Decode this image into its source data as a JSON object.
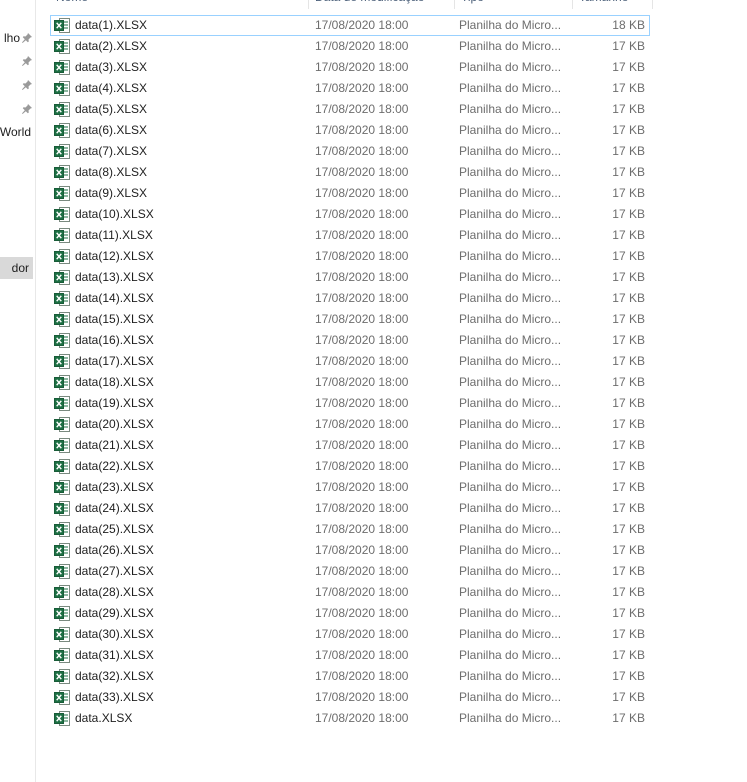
{
  "columns": {
    "name": "Nome",
    "date": "Data de modificação",
    "type": "Tipo",
    "size": "Tamanho"
  },
  "nav": {
    "items": [
      {
        "label": "lho",
        "pinned": true
      },
      {
        "label": "",
        "pinned": true
      },
      {
        "label": "",
        "pinned": true
      },
      {
        "label": "",
        "pinned": true
      },
      {
        "label": "World",
        "pinned": false
      },
      {
        "label": "dor",
        "pinned": false,
        "selected": true
      }
    ]
  },
  "icons": {
    "file": "excel-file-icon",
    "pin": "pin-icon"
  },
  "colors": {
    "excel_green": "#1d7044",
    "focus_border": "#99d1ff",
    "nav_selected": "#d9d9d9"
  },
  "files": [
    {
      "name": "data(1).XLSX",
      "date": "17/08/2020 18:00",
      "type": "Planilha do Micro...",
      "size": "18 KB"
    },
    {
      "name": "data(2).XLSX",
      "date": "17/08/2020 18:00",
      "type": "Planilha do Micro...",
      "size": "17 KB"
    },
    {
      "name": "data(3).XLSX",
      "date": "17/08/2020 18:00",
      "type": "Planilha do Micro...",
      "size": "17 KB"
    },
    {
      "name": "data(4).XLSX",
      "date": "17/08/2020 18:00",
      "type": "Planilha do Micro...",
      "size": "17 KB"
    },
    {
      "name": "data(5).XLSX",
      "date": "17/08/2020 18:00",
      "type": "Planilha do Micro...",
      "size": "17 KB"
    },
    {
      "name": "data(6).XLSX",
      "date": "17/08/2020 18:00",
      "type": "Planilha do Micro...",
      "size": "17 KB"
    },
    {
      "name": "data(7).XLSX",
      "date": "17/08/2020 18:00",
      "type": "Planilha do Micro...",
      "size": "17 KB"
    },
    {
      "name": "data(8).XLSX",
      "date": "17/08/2020 18:00",
      "type": "Planilha do Micro...",
      "size": "17 KB"
    },
    {
      "name": "data(9).XLSX",
      "date": "17/08/2020 18:00",
      "type": "Planilha do Micro...",
      "size": "17 KB"
    },
    {
      "name": "data(10).XLSX",
      "date": "17/08/2020 18:00",
      "type": "Planilha do Micro...",
      "size": "17 KB"
    },
    {
      "name": "data(11).XLSX",
      "date": "17/08/2020 18:00",
      "type": "Planilha do Micro...",
      "size": "17 KB"
    },
    {
      "name": "data(12).XLSX",
      "date": "17/08/2020 18:00",
      "type": "Planilha do Micro...",
      "size": "17 KB"
    },
    {
      "name": "data(13).XLSX",
      "date": "17/08/2020 18:00",
      "type": "Planilha do Micro...",
      "size": "17 KB"
    },
    {
      "name": "data(14).XLSX",
      "date": "17/08/2020 18:00",
      "type": "Planilha do Micro...",
      "size": "17 KB"
    },
    {
      "name": "data(15).XLSX",
      "date": "17/08/2020 18:00",
      "type": "Planilha do Micro...",
      "size": "17 KB"
    },
    {
      "name": "data(16).XLSX",
      "date": "17/08/2020 18:00",
      "type": "Planilha do Micro...",
      "size": "17 KB"
    },
    {
      "name": "data(17).XLSX",
      "date": "17/08/2020 18:00",
      "type": "Planilha do Micro...",
      "size": "17 KB"
    },
    {
      "name": "data(18).XLSX",
      "date": "17/08/2020 18:00",
      "type": "Planilha do Micro...",
      "size": "17 KB"
    },
    {
      "name": "data(19).XLSX",
      "date": "17/08/2020 18:00",
      "type": "Planilha do Micro...",
      "size": "17 KB"
    },
    {
      "name": "data(20).XLSX",
      "date": "17/08/2020 18:00",
      "type": "Planilha do Micro...",
      "size": "17 KB"
    },
    {
      "name": "data(21).XLSX",
      "date": "17/08/2020 18:00",
      "type": "Planilha do Micro...",
      "size": "17 KB"
    },
    {
      "name": "data(22).XLSX",
      "date": "17/08/2020 18:00",
      "type": "Planilha do Micro...",
      "size": "17 KB"
    },
    {
      "name": "data(23).XLSX",
      "date": "17/08/2020 18:00",
      "type": "Planilha do Micro...",
      "size": "17 KB"
    },
    {
      "name": "data(24).XLSX",
      "date": "17/08/2020 18:00",
      "type": "Planilha do Micro...",
      "size": "17 KB"
    },
    {
      "name": "data(25).XLSX",
      "date": "17/08/2020 18:00",
      "type": "Planilha do Micro...",
      "size": "17 KB"
    },
    {
      "name": "data(26).XLSX",
      "date": "17/08/2020 18:00",
      "type": "Planilha do Micro...",
      "size": "17 KB"
    },
    {
      "name": "data(27).XLSX",
      "date": "17/08/2020 18:00",
      "type": "Planilha do Micro...",
      "size": "17 KB"
    },
    {
      "name": "data(28).XLSX",
      "date": "17/08/2020 18:00",
      "type": "Planilha do Micro...",
      "size": "17 KB"
    },
    {
      "name": "data(29).XLSX",
      "date": "17/08/2020 18:00",
      "type": "Planilha do Micro...",
      "size": "17 KB"
    },
    {
      "name": "data(30).XLSX",
      "date": "17/08/2020 18:00",
      "type": "Planilha do Micro...",
      "size": "17 KB"
    },
    {
      "name": "data(31).XLSX",
      "date": "17/08/2020 18:00",
      "type": "Planilha do Micro...",
      "size": "17 KB"
    },
    {
      "name": "data(32).XLSX",
      "date": "17/08/2020 18:00",
      "type": "Planilha do Micro...",
      "size": "17 KB"
    },
    {
      "name": "data(33).XLSX",
      "date": "17/08/2020 18:00",
      "type": "Planilha do Micro...",
      "size": "17 KB"
    },
    {
      "name": "data.XLSX",
      "date": "17/08/2020 18:00",
      "type": "Planilha do Micro...",
      "size": "17 KB"
    }
  ]
}
